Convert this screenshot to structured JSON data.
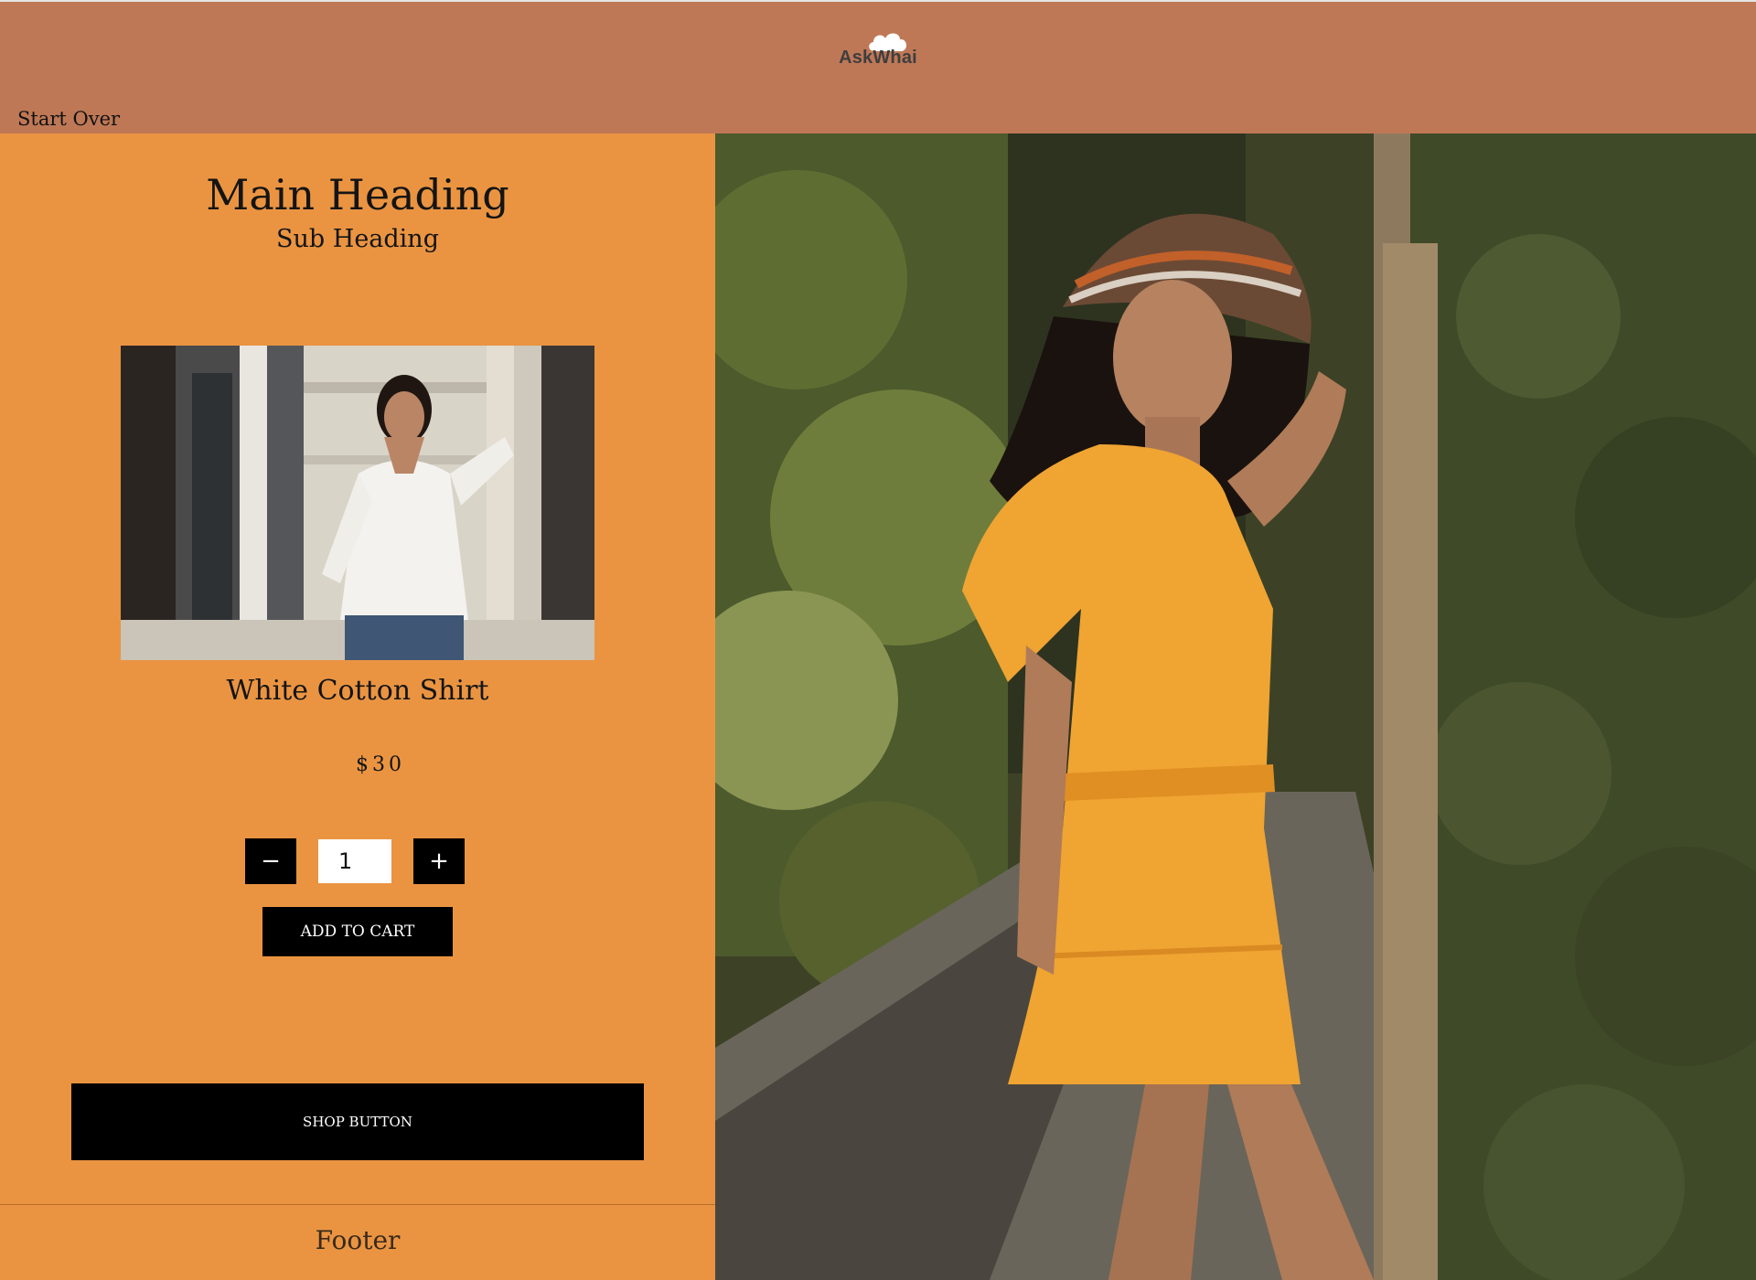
{
  "header": {
    "logo_text": "AskWhai",
    "start_over_label": "Start Over"
  },
  "product_panel": {
    "main_heading": "Main Heading",
    "sub_heading": "Sub Heading",
    "product_title": "White Cotton Shirt",
    "price": "$30",
    "quantity": "1",
    "minus_label": "−",
    "plus_label": "+",
    "add_to_cart_label": "ADD TO CART",
    "shop_button_label": "SHOP BUTTON",
    "footer_label": "Footer"
  },
  "colors": {
    "header_bg": "#bf7856",
    "panel_bg": "#ea9442",
    "button_bg": "#000000",
    "button_text": "#ffffff"
  },
  "icons": {
    "logo": "cloud-icon"
  }
}
